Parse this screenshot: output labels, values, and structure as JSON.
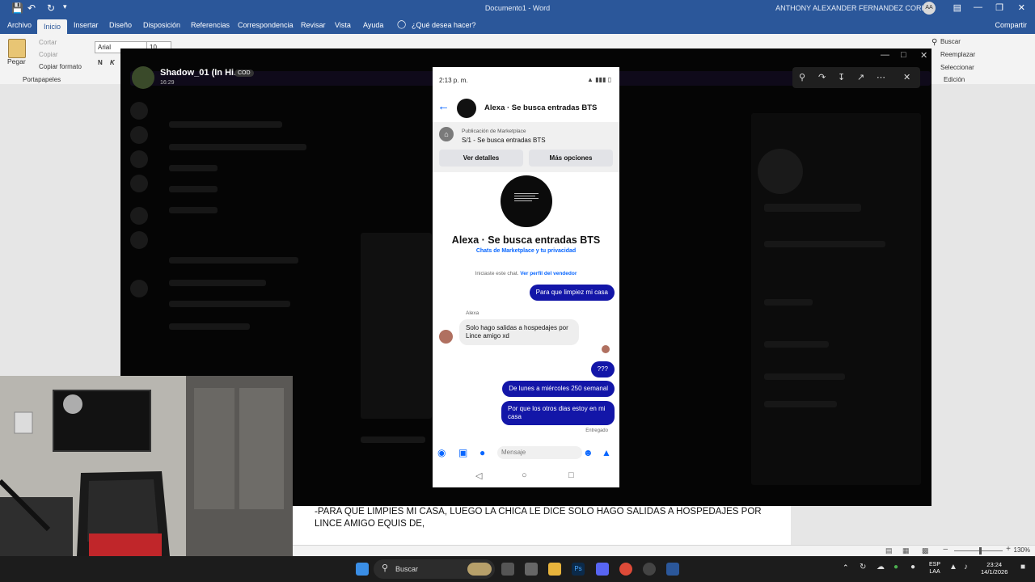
{
  "word": {
    "doc_title": "Documento1 - Word",
    "user_name": "ANTHONY ALEXANDER FERNANDEZ CORI",
    "user_initials": "AA",
    "tabs": [
      "Archivo",
      "Inicio",
      "Insertar",
      "Diseño",
      "Disposición",
      "Referencias",
      "Correspondencia",
      "Revisar",
      "Vista",
      "Ayuda"
    ],
    "tell_me": "¿Qué desea hacer?",
    "share": "Compartir",
    "clipboard": {
      "paste": "Pegar",
      "cut": "Cortar",
      "copy": "Copiar",
      "format_painter": "Copiar formato",
      "group": "Portapapeles"
    },
    "font_name": "Arial",
    "font_size": "10",
    "editing": {
      "find": "Buscar",
      "replace": "Reemplazar",
      "select": "Seleccionar",
      "group": "Edición"
    },
    "doc_text": "-PARA QUE LIMPIES MI CASA, LUEGO LA CHICA LE DICE SOLO HAGO SALIDAS A HOSPEDAJES POR LINCE AMIGO EQUIS DE,",
    "zoom": "130%"
  },
  "viewer": {
    "title": "Shadow_01 (In Hi...",
    "badge": "COD",
    "time": "16:29"
  },
  "phone": {
    "status_time": "2:13 p. m.",
    "conversation_title": "Alexa · Se busca entradas BTS",
    "marketplace_label": "Publicación de Marketplace",
    "marketplace_item": "S/1 - Se busca entradas BTS",
    "btn_details": "Ver detalles",
    "btn_more": "Más opciones",
    "profile_name": "Alexa · Se busca entradas BTS",
    "profile_sub": "Chats de Marketplace y tu privacidad",
    "started_text": "Iniciaste este chat.",
    "started_link": "Ver perfil del vendedor",
    "sender_name": "Alexa",
    "messages": [
      {
        "dir": "out",
        "text": "Para que limpiez mi casa"
      },
      {
        "dir": "in",
        "text": "Solo hago salidas a hospedajes por Lince amigo xd"
      },
      {
        "dir": "out",
        "text": "???"
      },
      {
        "dir": "out",
        "text": "De lunes a miércoles 250 semanal"
      },
      {
        "dir": "out",
        "text": "Por que los otros dias estoy en mi casa"
      }
    ],
    "delivered": "Entregado",
    "input_placeholder": "Mensaje"
  },
  "taskbar": {
    "search": "Buscar",
    "lang_1": "ESP",
    "lang_2": "LAA",
    "time": "23:24",
    "date": "14/1/2026"
  }
}
